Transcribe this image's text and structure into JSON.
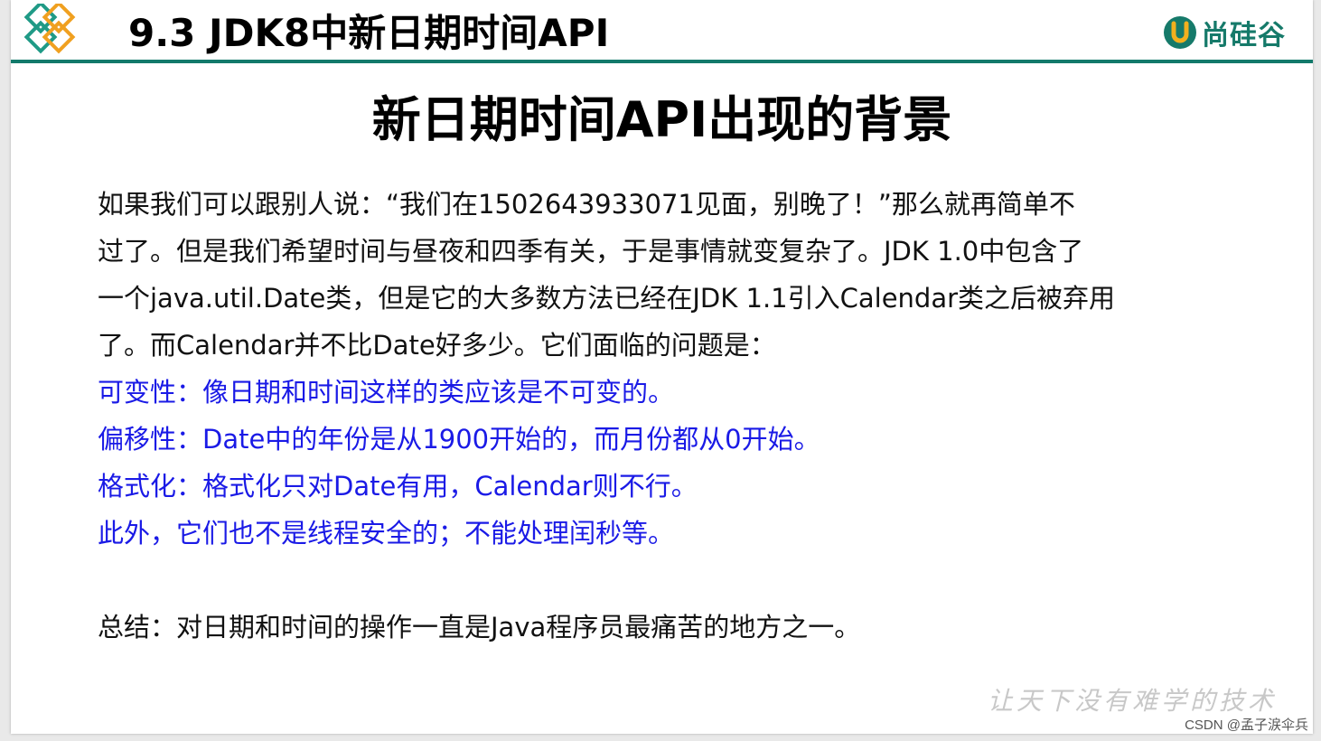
{
  "header": {
    "section_title": "9.3 JDK8中新日期时间API",
    "brand_name": "尚硅谷",
    "brand_color": "#167a6a",
    "rule_color": "#137a6b"
  },
  "slide": {
    "title": "新日期时间API出现的背景",
    "intro_lines": [
      "如果我们可以跟别人说：“我们在1502643933071见面，别晚了！”那么就再简单不",
      "过了。但是我们希望时间与昼夜和四季有关，于是事情就变复杂了。JDK 1.0中包含了",
      "一个java.util.Date类，但是它的大多数方法已经在JDK 1.1引入Calendar类之后被弃用",
      "了。而Calendar并不比Date好多少。它们面临的问题是："
    ],
    "problems": [
      "可变性：像日期和时间这样的类应该是不可变的。",
      "偏移性：Date中的年份是从1900开始的，而月份都从0开始。",
      "格式化：格式化只对Date有用，Calendar则不行。",
      "此外，它们也不是线程安全的；不能处理闰秒等。"
    ],
    "problem_color": "#1a1ae6",
    "summary": "总结：对日期和时间的操作一直是Java程序员最痛苦的地方之一。",
    "watermark": "让天下没有难学的技术"
  },
  "credit": {
    "text": "CSDN @孟子涙伞兵"
  }
}
